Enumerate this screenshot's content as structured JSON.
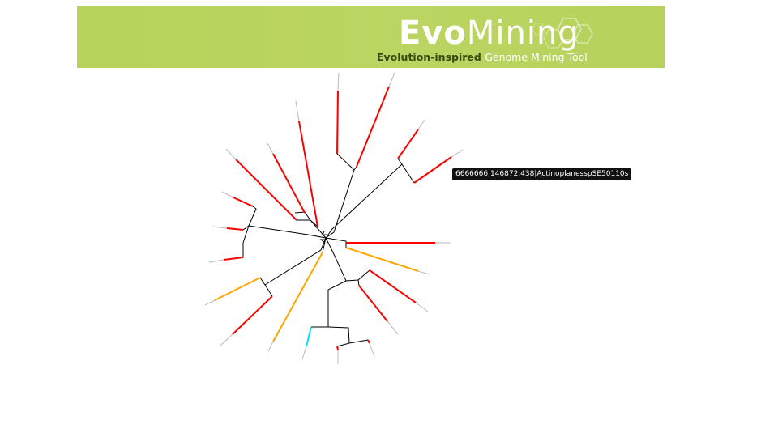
{
  "header": {
    "logo_evo": "Evo",
    "logo_mining": "Mining",
    "tagline_dark": "Evolution-inspired ",
    "tagline_light": "Genome Mining Tool"
  },
  "tooltip": {
    "text": "6666666.146872.438|ActinoplanesspSE50110s"
  },
  "colors": {
    "background": "#ffffff",
    "banner_green": "#b8d45c",
    "branch": "#000000",
    "leaf_red": "#ff0000",
    "leaf_orange": "#ffa500",
    "leaf_cyan": "#00e5ee",
    "leaf_tip": "#bbbbbb"
  }
}
